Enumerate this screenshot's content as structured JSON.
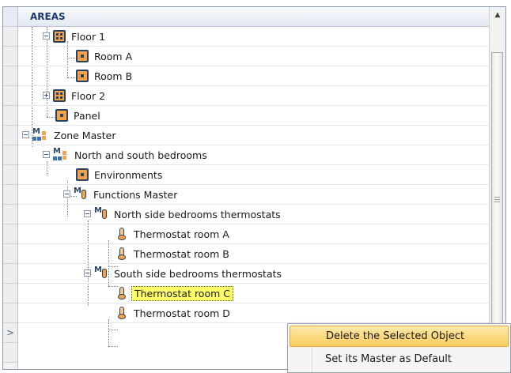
{
  "tree": {
    "header": "AREAS",
    "nodes": [
      {
        "label": "Floor 1"
      },
      {
        "label": "Room A"
      },
      {
        "label": "Room B"
      },
      {
        "label": "Floor 2"
      },
      {
        "label": "Panel"
      },
      {
        "label": "Zone Master"
      },
      {
        "label": "North and south bedrooms"
      },
      {
        "label": "Environments"
      },
      {
        "label": "Functions Master"
      },
      {
        "label": "North side bedrooms thermostats"
      },
      {
        "label": "Thermostat room A"
      },
      {
        "label": "Thermostat room B"
      },
      {
        "label": "South side bedrooms thermostats"
      },
      {
        "label": "Thermostat room C",
        "selected": true
      },
      {
        "label": "Thermostat room D"
      }
    ]
  },
  "context_menu": {
    "items": [
      {
        "label": "Delete the Selected Object"
      },
      {
        "label": "Set its Master as Default"
      }
    ]
  },
  "colors": {
    "selection_highlight": "#ffff66",
    "menu_hover": "#f9cc5d",
    "icon_orange": "#f5a24b",
    "icon_navy": "#28445f"
  }
}
